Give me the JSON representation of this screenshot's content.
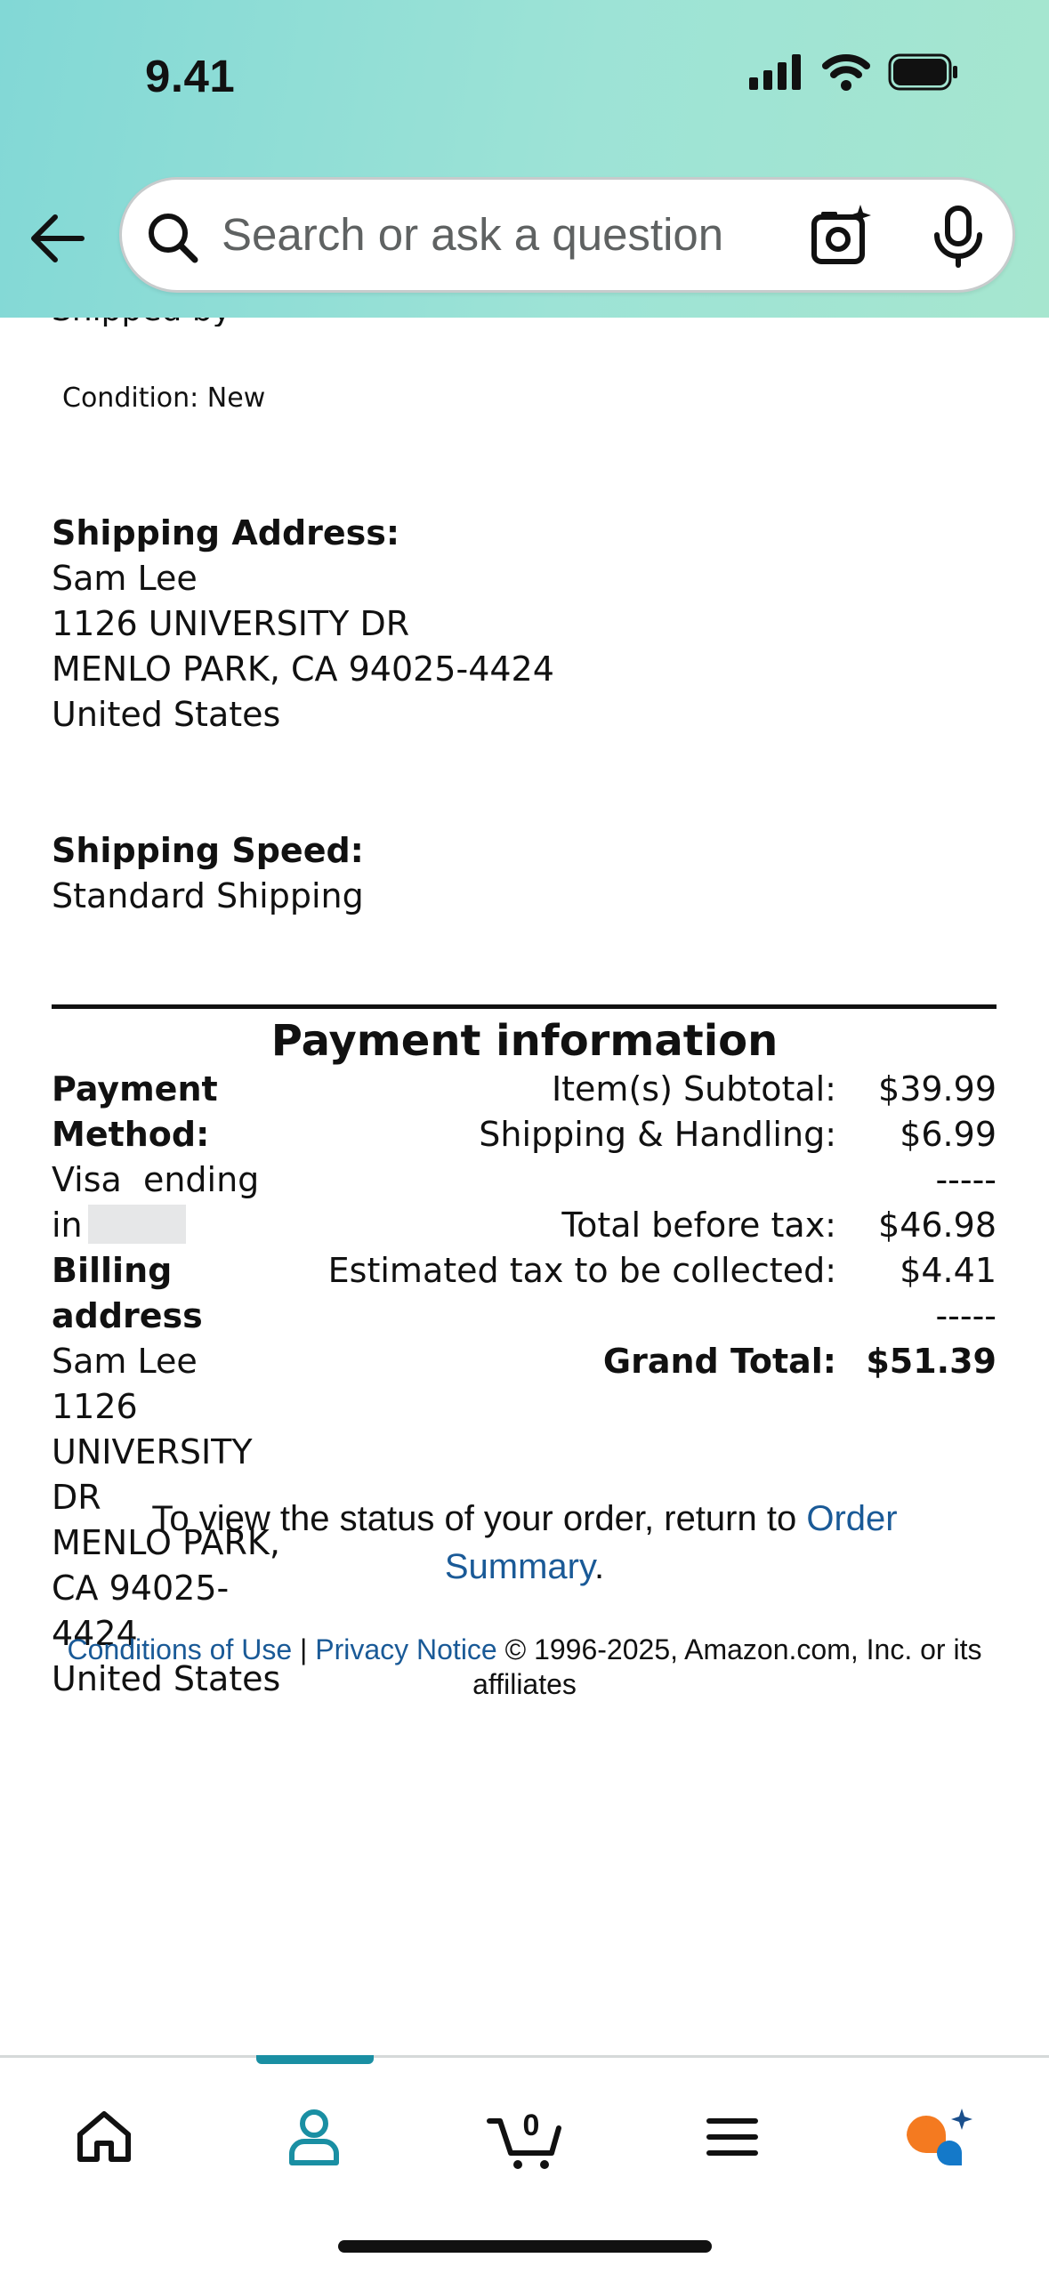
{
  "status_bar": {
    "time": "9.41"
  },
  "search": {
    "placeholder": "Search or ask a question"
  },
  "item": {
    "cut_text": "Shipped by Seller",
    "condition": "Condition: New"
  },
  "shipping_address": {
    "label": "Shipping Address:",
    "lines": [
      "Sam Lee",
      "1126 UNIVERSITY DR",
      "MENLO PARK, CA 94025-4424",
      "United States"
    ]
  },
  "shipping_speed": {
    "label": "Shipping Speed:",
    "value": "Standard Shipping"
  },
  "payment": {
    "title": "Payment information",
    "method_label_1": "Payment",
    "method_label_2": "Method:",
    "method_line_1": "Visa  ending",
    "method_line_2": "in",
    "billing_label_1": "Billing",
    "billing_label_2": "address",
    "billing_lines": [
      "Sam Lee",
      "1126",
      "UNIVERSITY",
      "DR",
      "MENLO PARK,",
      "CA 94025-",
      "4424",
      "United States"
    ],
    "summary": [
      {
        "label": "Item(s) Subtotal:",
        "value": "$39.99"
      },
      {
        "label": "Shipping & Handling:",
        "value": "$6.99"
      },
      {
        "label": "",
        "value": "-----"
      },
      {
        "label": "Total before tax:",
        "value": "$46.98"
      },
      {
        "label": "Estimated tax to be collected:",
        "value": "$4.41"
      },
      {
        "label": "",
        "value": "-----"
      },
      {
        "label": "Grand Total:",
        "value": "$51.39"
      }
    ]
  },
  "status_note": {
    "prefix": "To view the status of your order, return to ",
    "link_1": "Order",
    "link_2": "Summary",
    "suffix": "."
  },
  "footer": {
    "conditions": "Conditions of Use",
    "separator": " | ",
    "privacy": "Privacy Notice",
    "copyright": " © 1996-2025, Amazon.com, Inc. or its",
    "copyright_2": "affiliates"
  },
  "bottom_nav": {
    "cart_count": "0",
    "active_tab": "account"
  },
  "colors": {
    "link": "#1a5a97",
    "accent": "#1a8fa3",
    "header_start": "#82d8d6",
    "header_end": "#a6e6cf"
  }
}
